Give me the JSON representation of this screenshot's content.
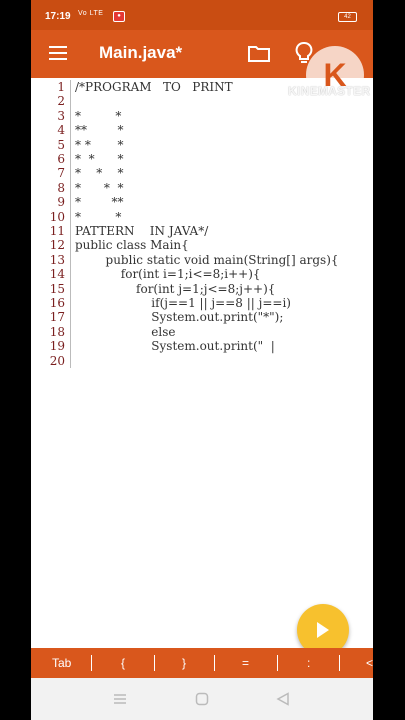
{
  "status": {
    "time": "17:19",
    "network": "Vo LTE",
    "battery": "42"
  },
  "app": {
    "title": "Main.java*"
  },
  "watermark": {
    "badge": "K",
    "brand": "KINEMASTER"
  },
  "code_lines": [
    {
      "n": "1",
      "text": "/*PROGRAM   TO   PRINT"
    },
    {
      "n": "2",
      "text": ""
    },
    {
      "n": "3",
      "text": "*         *"
    },
    {
      "n": "4",
      "text": "**        *"
    },
    {
      "n": "5",
      "text": "* *       *"
    },
    {
      "n": "6",
      "text": "*  *      *"
    },
    {
      "n": "7",
      "text": "*    *    *"
    },
    {
      "n": "8",
      "text": "*      *  *"
    },
    {
      "n": "9",
      "text": "*        **"
    },
    {
      "n": "10",
      "text": "*         *"
    },
    {
      "n": "11",
      "text": "PATTERN    IN JAVA*/"
    },
    {
      "n": "12",
      "text": "public class Main{"
    },
    {
      "n": "13",
      "text": "        public static void main(String[] args){"
    },
    {
      "n": "14",
      "text": "            for(int i=1;i<=8;i++){"
    },
    {
      "n": "15",
      "text": "                for(int j=1;j<=8;j++){"
    },
    {
      "n": "16",
      "text": "                    if(j==1 || j==8 || j==i)"
    },
    {
      "n": "17",
      "text": "                    System.out.print(\"*\");"
    },
    {
      "n": "18",
      "text": "                    else"
    },
    {
      "n": "19",
      "text": "                    System.out.print(\"  |"
    },
    {
      "n": "20",
      "text": ""
    }
  ],
  "toolbar": {
    "tab": "Tab",
    "lbrace": "{",
    "rbrace": "}",
    "equals": "=",
    "colon": ":",
    "less": "<"
  }
}
